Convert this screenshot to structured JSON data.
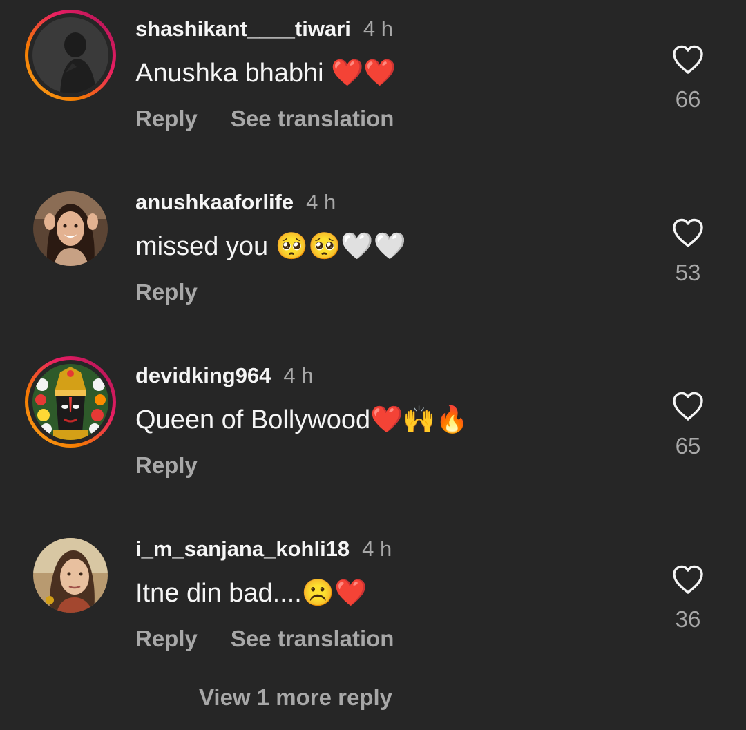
{
  "comments": [
    {
      "username": "shashikant____tiwari",
      "time": "4 h",
      "text": "Anushka bhabhi ❤️❤️",
      "reply_label": "Reply",
      "translation_label": "See translation",
      "likes": "66",
      "avatar_ring": "story"
    },
    {
      "username": "anushkaaforlife",
      "time": "4 h",
      "text": "missed you 🥺🥺🤍🤍",
      "reply_label": "Reply",
      "likes": "53",
      "avatar_ring": "none"
    },
    {
      "username": "devidking964",
      "time": "4 h",
      "text": "Queen of Bollywood❤️🙌🔥",
      "reply_label": "Reply",
      "likes": "65",
      "avatar_ring": "story"
    },
    {
      "username": "i_m_sanjana_kohli18",
      "time": "4 h",
      "text": "Itne din bad....☹️❤️",
      "reply_label": "Reply",
      "translation_label": "See translation",
      "likes": "36",
      "avatar_ring": "none"
    }
  ],
  "view_more_label": "View 1 more reply",
  "icons": {
    "like": "heart-outline-icon"
  },
  "colors": {
    "background": "#262626",
    "primary_text": "#f5f5f5",
    "secondary_text": "#a8a8a8"
  }
}
